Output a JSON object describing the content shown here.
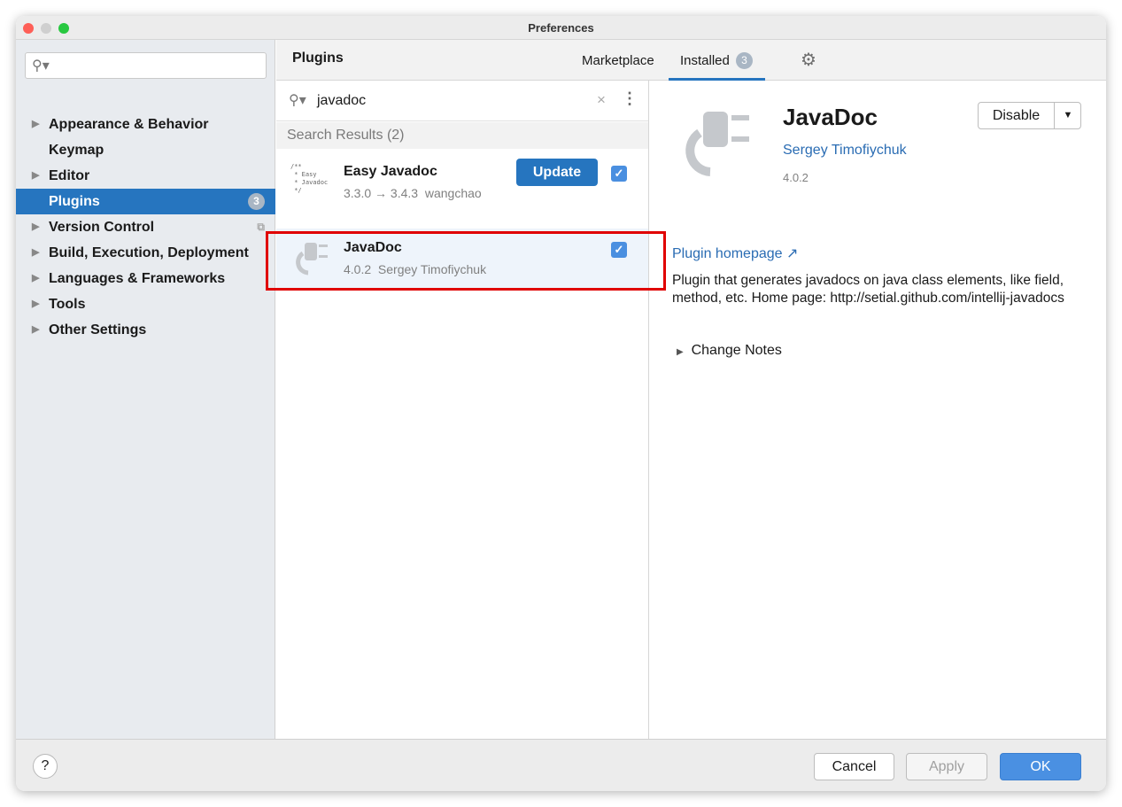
{
  "window": {
    "title": "Preferences"
  },
  "sidebar": {
    "search_placeholder": "",
    "items": [
      {
        "label": "Appearance & Behavior",
        "expandable": true
      },
      {
        "label": "Keymap",
        "expandable": false
      },
      {
        "label": "Editor",
        "expandable": true
      },
      {
        "label": "Plugins",
        "expandable": false,
        "selected": true,
        "badge": "3"
      },
      {
        "label": "Version Control",
        "expandable": true
      },
      {
        "label": "Build, Execution, Deployment",
        "expandable": true
      },
      {
        "label": "Languages & Frameworks",
        "expandable": true
      },
      {
        "label": "Tools",
        "expandable": true
      },
      {
        "label": "Other Settings",
        "expandable": true
      }
    ]
  },
  "header": {
    "title": "Plugins",
    "tabs": [
      {
        "label": "Marketplace"
      },
      {
        "label": "Installed",
        "badge": "3",
        "active": true
      }
    ]
  },
  "search": {
    "value": "javadoc"
  },
  "results": {
    "heading": "Search Results (2)",
    "items": [
      {
        "name": "Easy Javadoc",
        "icon_text": "/**\n * Easy\n * Javadoc\n */",
        "meta_version": "3.3.0 → 3.4.3",
        "meta_author": "wangchao",
        "button": "Update",
        "enabled": true
      },
      {
        "name": "JavaDoc",
        "meta_version": "4.0.2",
        "meta_author": "Sergey Timofiychuk",
        "enabled": true,
        "highlighted": true
      }
    ]
  },
  "detail": {
    "name": "JavaDoc",
    "author": "Sergey Timofiychuk",
    "version": "4.0.2",
    "disable_label": "Disable",
    "homepage_label": "Plugin homepage ↗",
    "description": "Plugin that generates javadocs on java class elements, like field, method, etc. Home page: http://setial.github.com/intellij-javadocs",
    "change_notes": "Change Notes"
  },
  "footer": {
    "cancel": "Cancel",
    "apply": "Apply",
    "ok": "OK"
  },
  "colors": {
    "accent": "#2675bf",
    "highlight": "#e00000"
  }
}
